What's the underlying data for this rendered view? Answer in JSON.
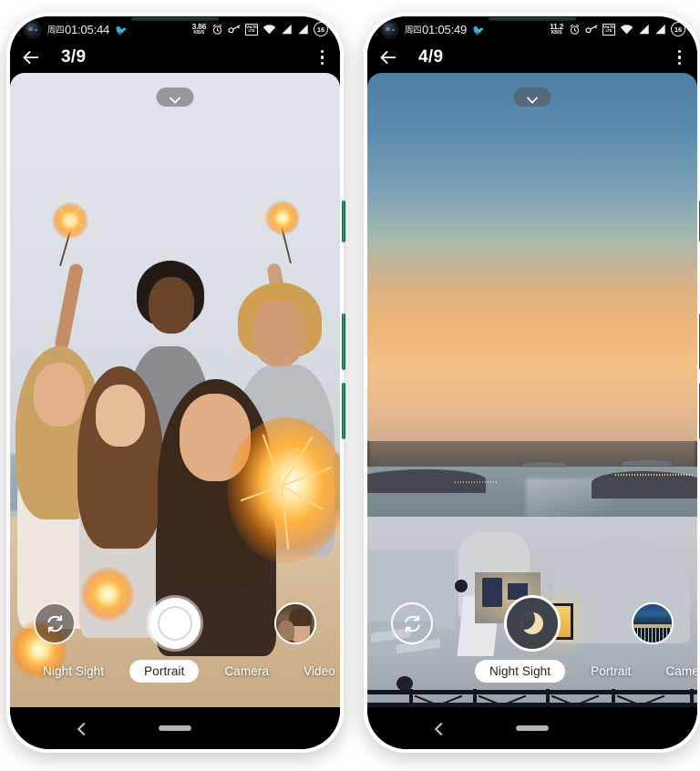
{
  "meta": {
    "app": "camera-screenshot-gallery",
    "layout": "two-phone-mockups-side-by-side"
  },
  "colors": {
    "frame_teal": "#0c5247",
    "frame_teal_light": "#6fc9bb",
    "screen_black": "#000000",
    "accent_white": "#ffffff",
    "mode_active_pill": "#ffffff",
    "mode_active_text": "#202124",
    "night_shutter_fill": "#3e4449",
    "moon_color": "#f3e0b0",
    "nav_icon": "#c9c9c9"
  },
  "phones": [
    {
      "id": "phone-left",
      "statusbar": {
        "day": "周四",
        "time": "01:05:44",
        "notification_icon": "bird-icon",
        "net_speed_value": "3.86",
        "net_speed_unit": "KB/S",
        "icons": [
          "alarm-icon",
          "vpn-key-icon",
          "volte-icon",
          "wifi-icon",
          "signal-sim1-icon",
          "signal-sim2-icon"
        ],
        "volte_label_top": "VoLTE",
        "volte_label_bottom": "LTE",
        "battery_level": "16"
      },
      "appbar": {
        "back_icon": "back-arrow-icon",
        "title": "3/9",
        "overflow_icon": "overflow-menu-icon"
      },
      "viewfinder": {
        "scene": "beach group selfie with sparklers",
        "expand_icon": "chevron-down-icon"
      },
      "controls": {
        "flip_icon": "camera-flip-icon",
        "shutter_label": "shutter-button",
        "thumbnail_label": "last-photo-thumbnail",
        "thumbnail_scene": "woman with dog"
      },
      "modes": {
        "items": [
          "Night Sight",
          "Portrait",
          "Camera",
          "Video"
        ],
        "active": "Portrait",
        "active_index": 1
      },
      "navbar": {
        "back_icon": "nav-back-icon",
        "home_icon": "nav-home-pill-icon"
      }
    },
    {
      "id": "phone-right",
      "statusbar": {
        "day": "周四",
        "time": "01:05:49",
        "notification_icon": "bird-icon",
        "net_speed_value": "11.2",
        "net_speed_unit": "KB/S",
        "icons": [
          "alarm-icon",
          "vpn-key-icon",
          "volte-icon",
          "wifi-icon",
          "signal-sim1-icon",
          "signal-sim2-icon"
        ],
        "volte_label_top": "VoLTE",
        "volte_label_bottom": "LTE",
        "battery_level": "16"
      },
      "appbar": {
        "back_icon": "back-arrow-icon",
        "title": "4/9",
        "overflow_icon": "overflow-menu-icon"
      },
      "viewfinder": {
        "scene": "santorini sunset over sea with white buildings",
        "expand_icon": "chevron-down-icon"
      },
      "controls": {
        "flip_icon": "camera-flip-icon",
        "shutter_label": "night-sight-shutter-button",
        "shutter_icon": "moon-icon",
        "thumbnail_label": "last-photo-thumbnail",
        "thumbnail_scene": "night cityscape"
      },
      "modes": {
        "items": [
          "Night Sight",
          "Portrait",
          "Camer"
        ],
        "active": "Night Sight",
        "active_index": 0
      },
      "navbar": {
        "back_icon": "nav-back-icon",
        "home_icon": "nav-home-pill-icon"
      }
    }
  ]
}
